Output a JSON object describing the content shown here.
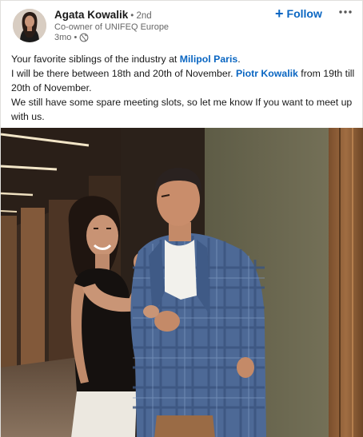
{
  "author": {
    "name": "Agata Kowalik",
    "degree": "• 2nd",
    "headline": "Co-owner of UNIFEQ Europe",
    "time": "3mo •",
    "visibility_icon": "globe-icon"
  },
  "actions": {
    "follow_label": "Follow",
    "more_icon": "more-dots-icon"
  },
  "post": {
    "line1_pre": "Your favorite siblings of the industry at ",
    "line1_mention": "Milipol Paris",
    "line1_post": ".",
    "line2_pre": "I will be there between 18th and 20th of November. ",
    "line2_mention": "Piotr Kowalik",
    "line2_post": " from 19th till 20th of November.",
    "line3": "We still have some spare meeting slots, so let me know If you want to meet up with us."
  },
  "colors": {
    "link": "#0a66c2",
    "text": "#191919",
    "muted": "#666666"
  }
}
